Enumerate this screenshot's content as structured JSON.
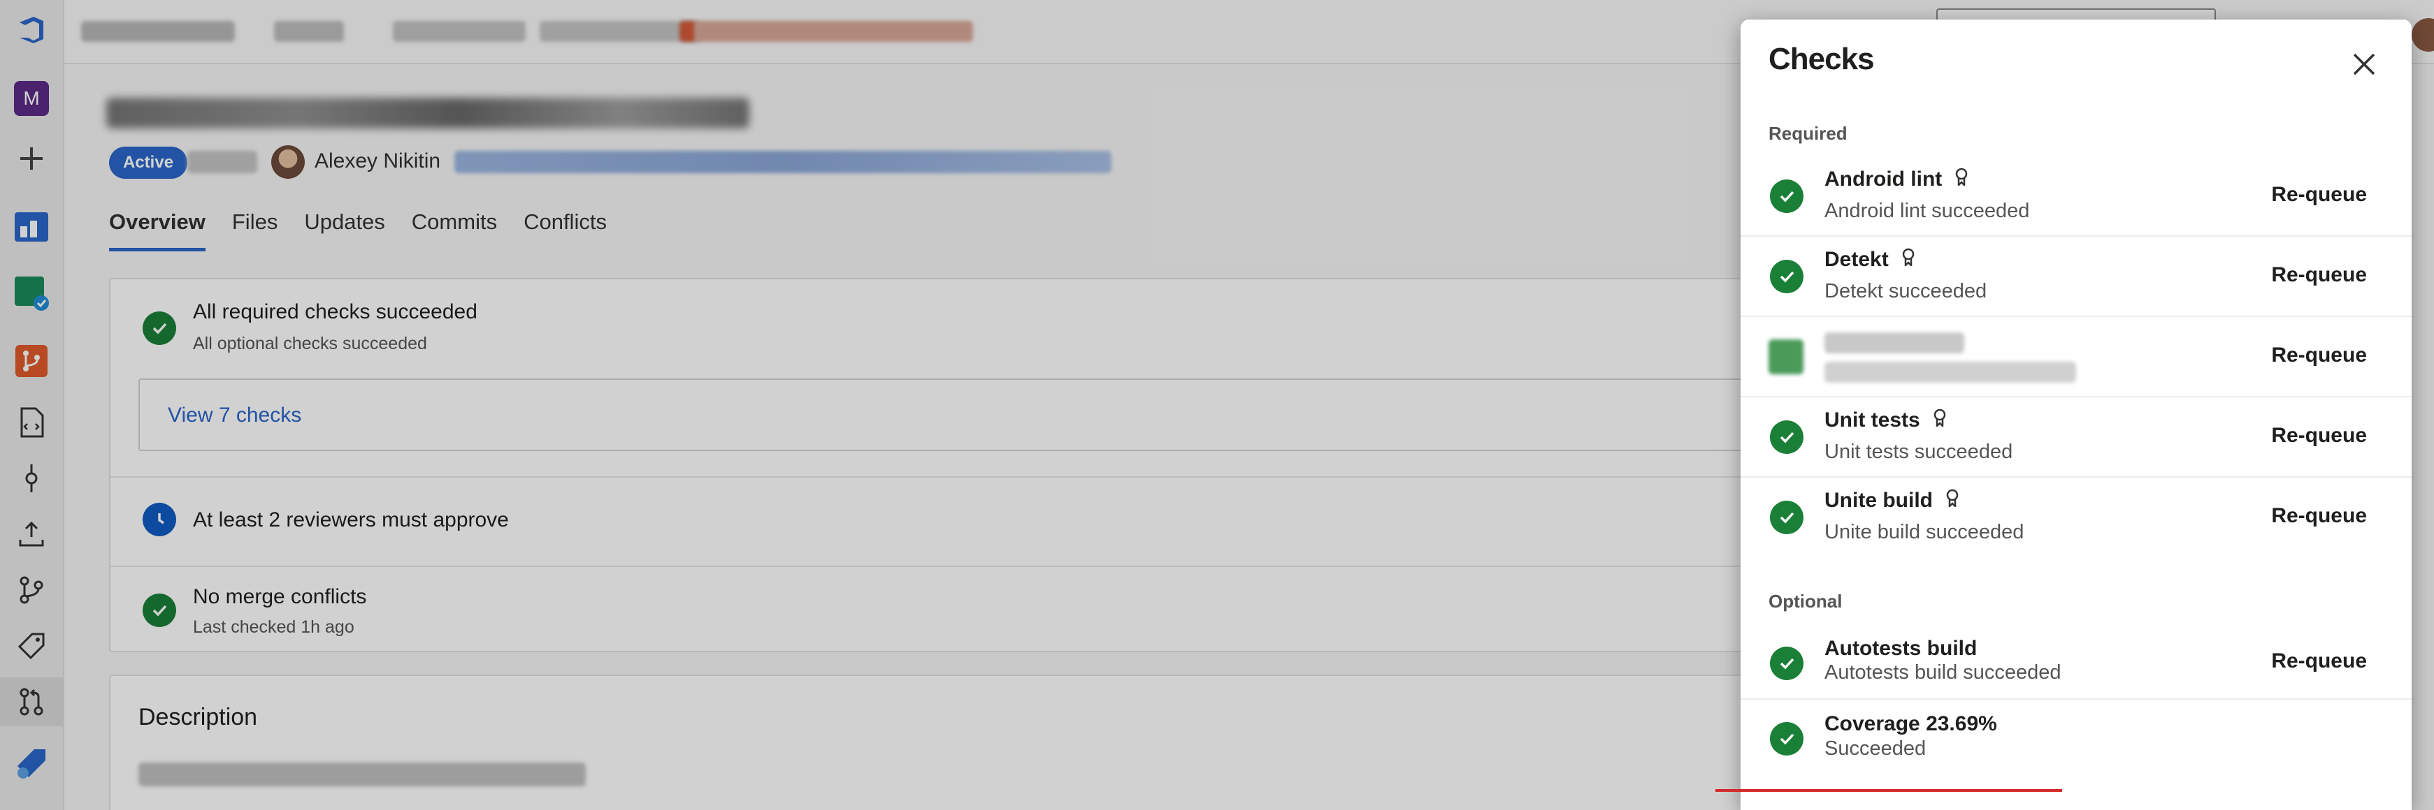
{
  "colors": {
    "accent": "#2a66c8",
    "success": "#1a7f37",
    "clock": "#0f5cc2",
    "panel_bg": "#ffffff"
  },
  "left_rail": {
    "items": [
      {
        "name": "azure-devops-logo-icon"
      },
      {
        "name": "project-avatar-icon",
        "label": "M"
      },
      {
        "name": "plus-icon"
      },
      {
        "name": "overview-icon"
      },
      {
        "name": "boards-icon"
      },
      {
        "name": "repos-icon"
      },
      {
        "name": "files-icon"
      },
      {
        "name": "commits-icon"
      },
      {
        "name": "pushes-icon"
      },
      {
        "name": "branches-icon"
      },
      {
        "name": "tags-icon"
      },
      {
        "name": "pull-requests-icon"
      },
      {
        "name": "pipelines-icon"
      }
    ]
  },
  "pr": {
    "status": "Active",
    "author": "Alexey Nikitin",
    "tabs": [
      "Overview",
      "Files",
      "Updates",
      "Commits",
      "Conflicts"
    ]
  },
  "overview": {
    "checks_title": "All required checks succeeded",
    "checks_sub": "All optional checks succeeded",
    "view_checks": "View 7 checks",
    "reviewers": "At least 2 reviewers must approve",
    "conflicts_title": "No merge conflicts",
    "conflicts_sub": "Last checked 1h ago",
    "description_heading": "Description"
  },
  "panel": {
    "title": "Checks",
    "required_label": "Required",
    "optional_label": "Optional",
    "requeue_label": "Re-queue",
    "required": [
      {
        "name": "Android lint",
        "status": "Android lint succeeded",
        "pinned": true
      },
      {
        "name": "Detekt",
        "status": "Detekt succeeded",
        "pinned": true
      },
      {
        "name": "",
        "status": "",
        "pinned": false,
        "redacted": true
      },
      {
        "name": "Unit tests",
        "status": "Unit tests succeeded",
        "pinned": true
      },
      {
        "name": "Unite build",
        "status": "Unite build succeeded",
        "pinned": true
      }
    ],
    "optional": [
      {
        "name": "Autotests build",
        "status": "Autotests build succeeded",
        "requeue": true
      },
      {
        "name": "Coverage 23.69%",
        "status": "Succeeded",
        "requeue": false
      }
    ]
  }
}
